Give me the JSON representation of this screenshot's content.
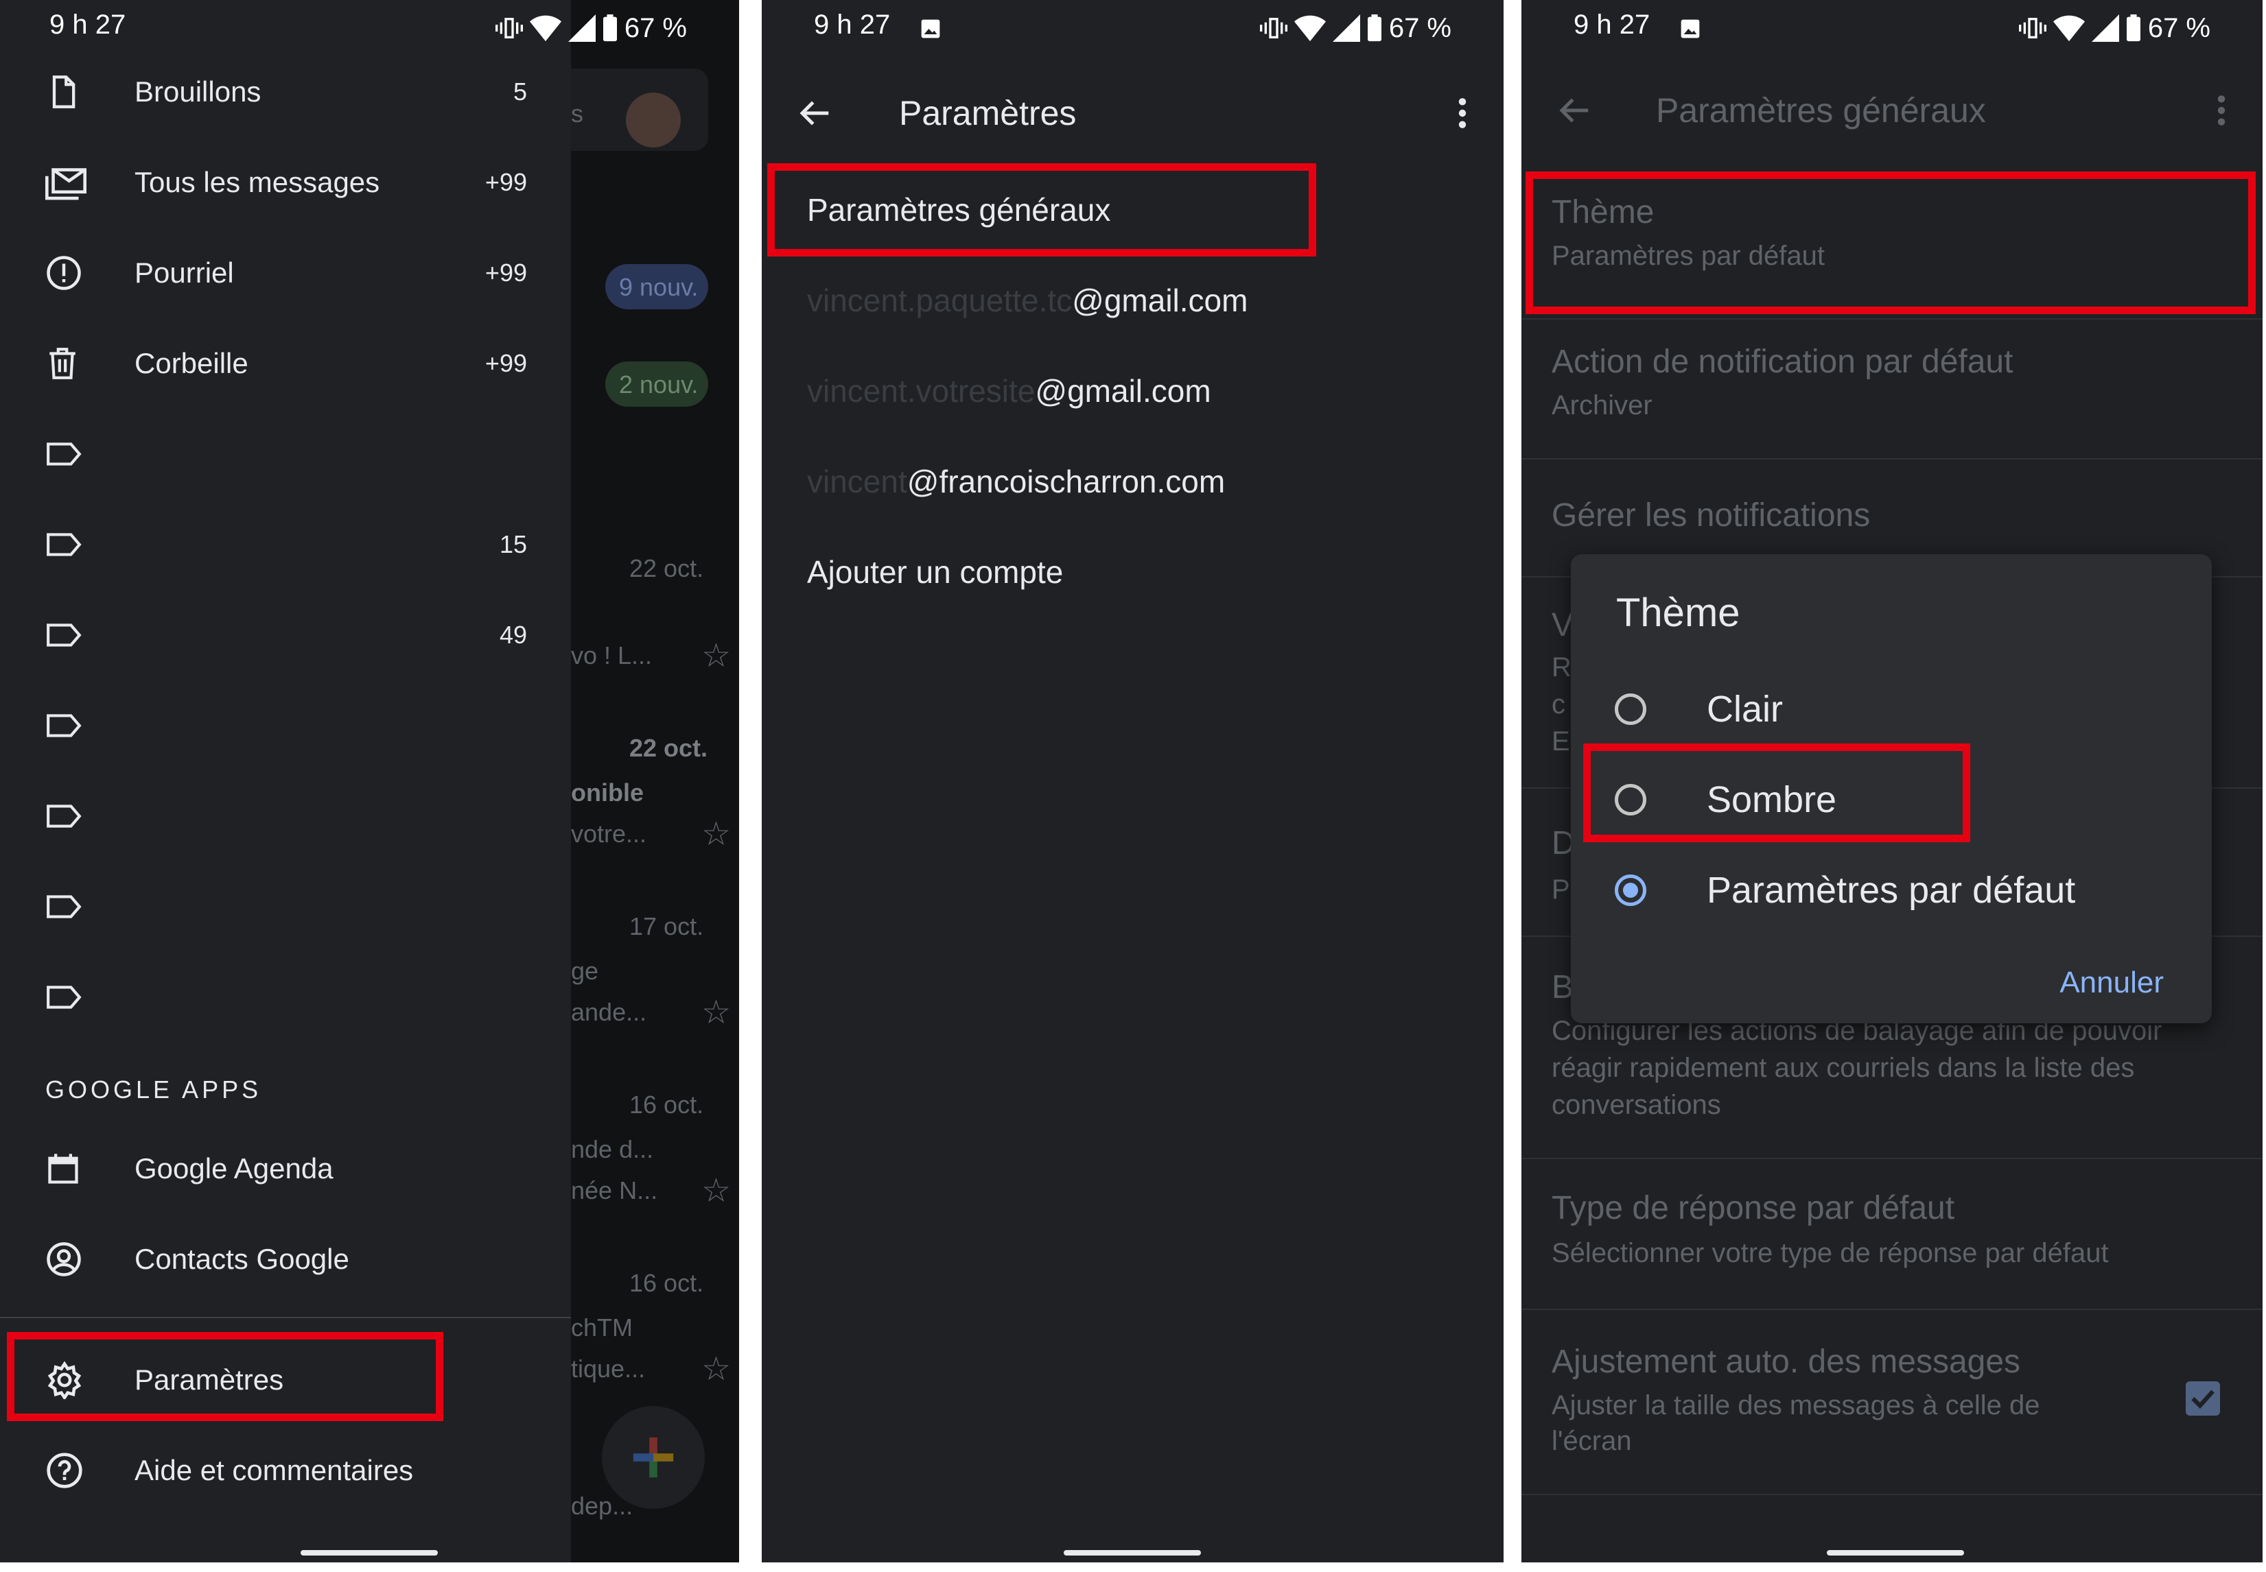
{
  "status_bar": {
    "time": "9 h 27",
    "battery": "67 %"
  },
  "panel1": {
    "nav_items": [
      {
        "label": "Brouillons",
        "count": "5",
        "icon": "draft-icon"
      },
      {
        "label": "Tous les messages",
        "count": "+99",
        "icon": "all-mail-icon"
      },
      {
        "label": "Pourriel",
        "count": "+99",
        "icon": "spam-icon"
      },
      {
        "label": "Corbeille",
        "count": "+99",
        "icon": "trash-icon"
      }
    ],
    "label_counts": [
      "",
      "15",
      "49",
      "",
      "",
      "",
      ""
    ],
    "section_title": "GOOGLE APPS",
    "apps": [
      {
        "label": "Google Agenda",
        "icon": "calendar-icon"
      },
      {
        "label": "Contacts Google",
        "icon": "contacts-icon"
      }
    ],
    "settings_label": "Paramètres",
    "help_label": "Aide et commentaires",
    "background": {
      "badges": [
        "9 nouv.",
        "2 nouv."
      ],
      "dates": [
        "22 oct.",
        "22 oct.",
        "17 oct.",
        "16 oct.",
        "16 oct."
      ],
      "fragments": [
        "s",
        "vo ! L...",
        "onible",
        "votre...",
        "ge",
        "ande...",
        "nde d...",
        "née N...",
        "chTM",
        "tique...",
        "dep..."
      ]
    }
  },
  "panel2": {
    "title": "Paramètres",
    "items": [
      {
        "visible": "",
        "text": "Paramètres généraux"
      },
      {
        "visible": "vincent.paquette.tc",
        "text": "@gmail.com"
      },
      {
        "visible": "vincent.votresite",
        "text": "@gmail.com"
      },
      {
        "visible": "vincent",
        "text": "@francoischarron.com"
      },
      {
        "visible": "",
        "text": "Ajouter un compte"
      }
    ]
  },
  "panel3": {
    "title": "Paramètres généraux",
    "settings": [
      {
        "title": "Thème",
        "subtitle": "Paramètres par défaut"
      },
      {
        "title": "Action de notification par défaut",
        "subtitle": "Archiver"
      },
      {
        "title": "Gérer les notifications",
        "subtitle": ""
      }
    ],
    "left_fragments": [
      "V",
      "R",
      "c",
      "E",
      "D",
      "P",
      "B"
    ],
    "swipe_desc": "Configurer les actions de balayage afin de pouvoir réagir rapidement aux courriels dans la liste des conversations",
    "reply": {
      "title": "Type de réponse par défaut",
      "subtitle": "Sélectionner votre type de réponse par défaut"
    },
    "autofit": {
      "title": "Ajustement auto. des messages",
      "subtitle1": "Ajuster la taille des messages à celle de",
      "subtitle2": "l'écran",
      "checked": true
    },
    "dialog": {
      "title": "Thème",
      "options": [
        "Clair",
        "Sombre",
        "Paramètres par défaut"
      ],
      "selected": "Paramètres par défaut",
      "cancel": "Annuler"
    }
  },
  "colors": {
    "highlight": "#e60012",
    "accent": "#8ab4f8",
    "background": "#202124"
  }
}
